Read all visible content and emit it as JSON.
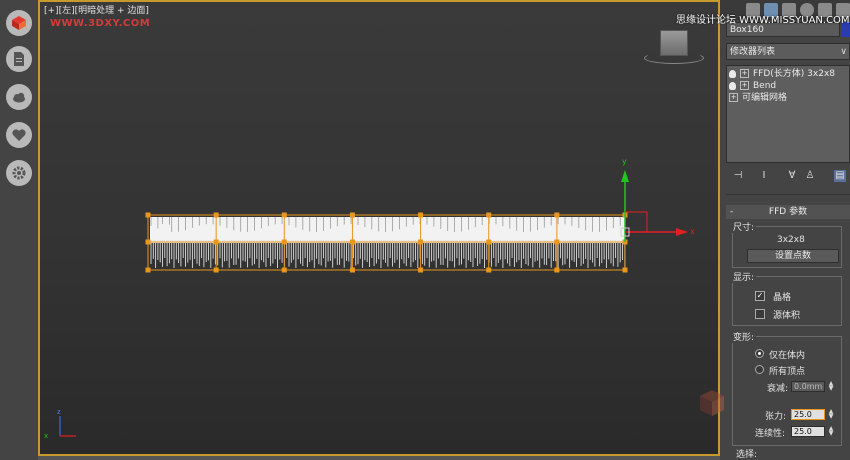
{
  "viewport": {
    "label": "[+][左][明暗处理 + 边面]",
    "watermark": "WWW.3DXY.COM",
    "axis_y": "y",
    "axis_x": "x",
    "mini_axis_z": "z",
    "mini_axis_x": "x"
  },
  "panel": {
    "site_watermark": "思缘设计论坛 WWW.MISSYUAN.COM",
    "object_name": "Box160",
    "object_color": "#2a3db0",
    "modifier_list": "修改器列表",
    "stack": [
      "FFD(长方体) 3x2x8",
      "Bend",
      "可编辑网格"
    ],
    "rollout_title": "FFD 参数",
    "dims_group": "尺寸:",
    "dims_value": "3x2x8",
    "set_points_btn": "设置点数",
    "display_group": "显示:",
    "lattice": "晶格",
    "source_volume": "源体积",
    "deform_group": "变形:",
    "only_in_volume": "仅在体内",
    "all_vertices": "所有顶点",
    "falloff_label": "衰减:",
    "falloff_value": "0.0mm",
    "tension_label": "张力:",
    "tension_value": "25.0",
    "continuity_label": "连续性:",
    "continuity_value": "25.0",
    "select_group": "选择:"
  },
  "colors": {
    "lattice": "#e8961e",
    "active_border": "#c89a2e",
    "axis_y": "#21c421",
    "axis_x": "#e02020",
    "highlight": "#e8961e"
  }
}
